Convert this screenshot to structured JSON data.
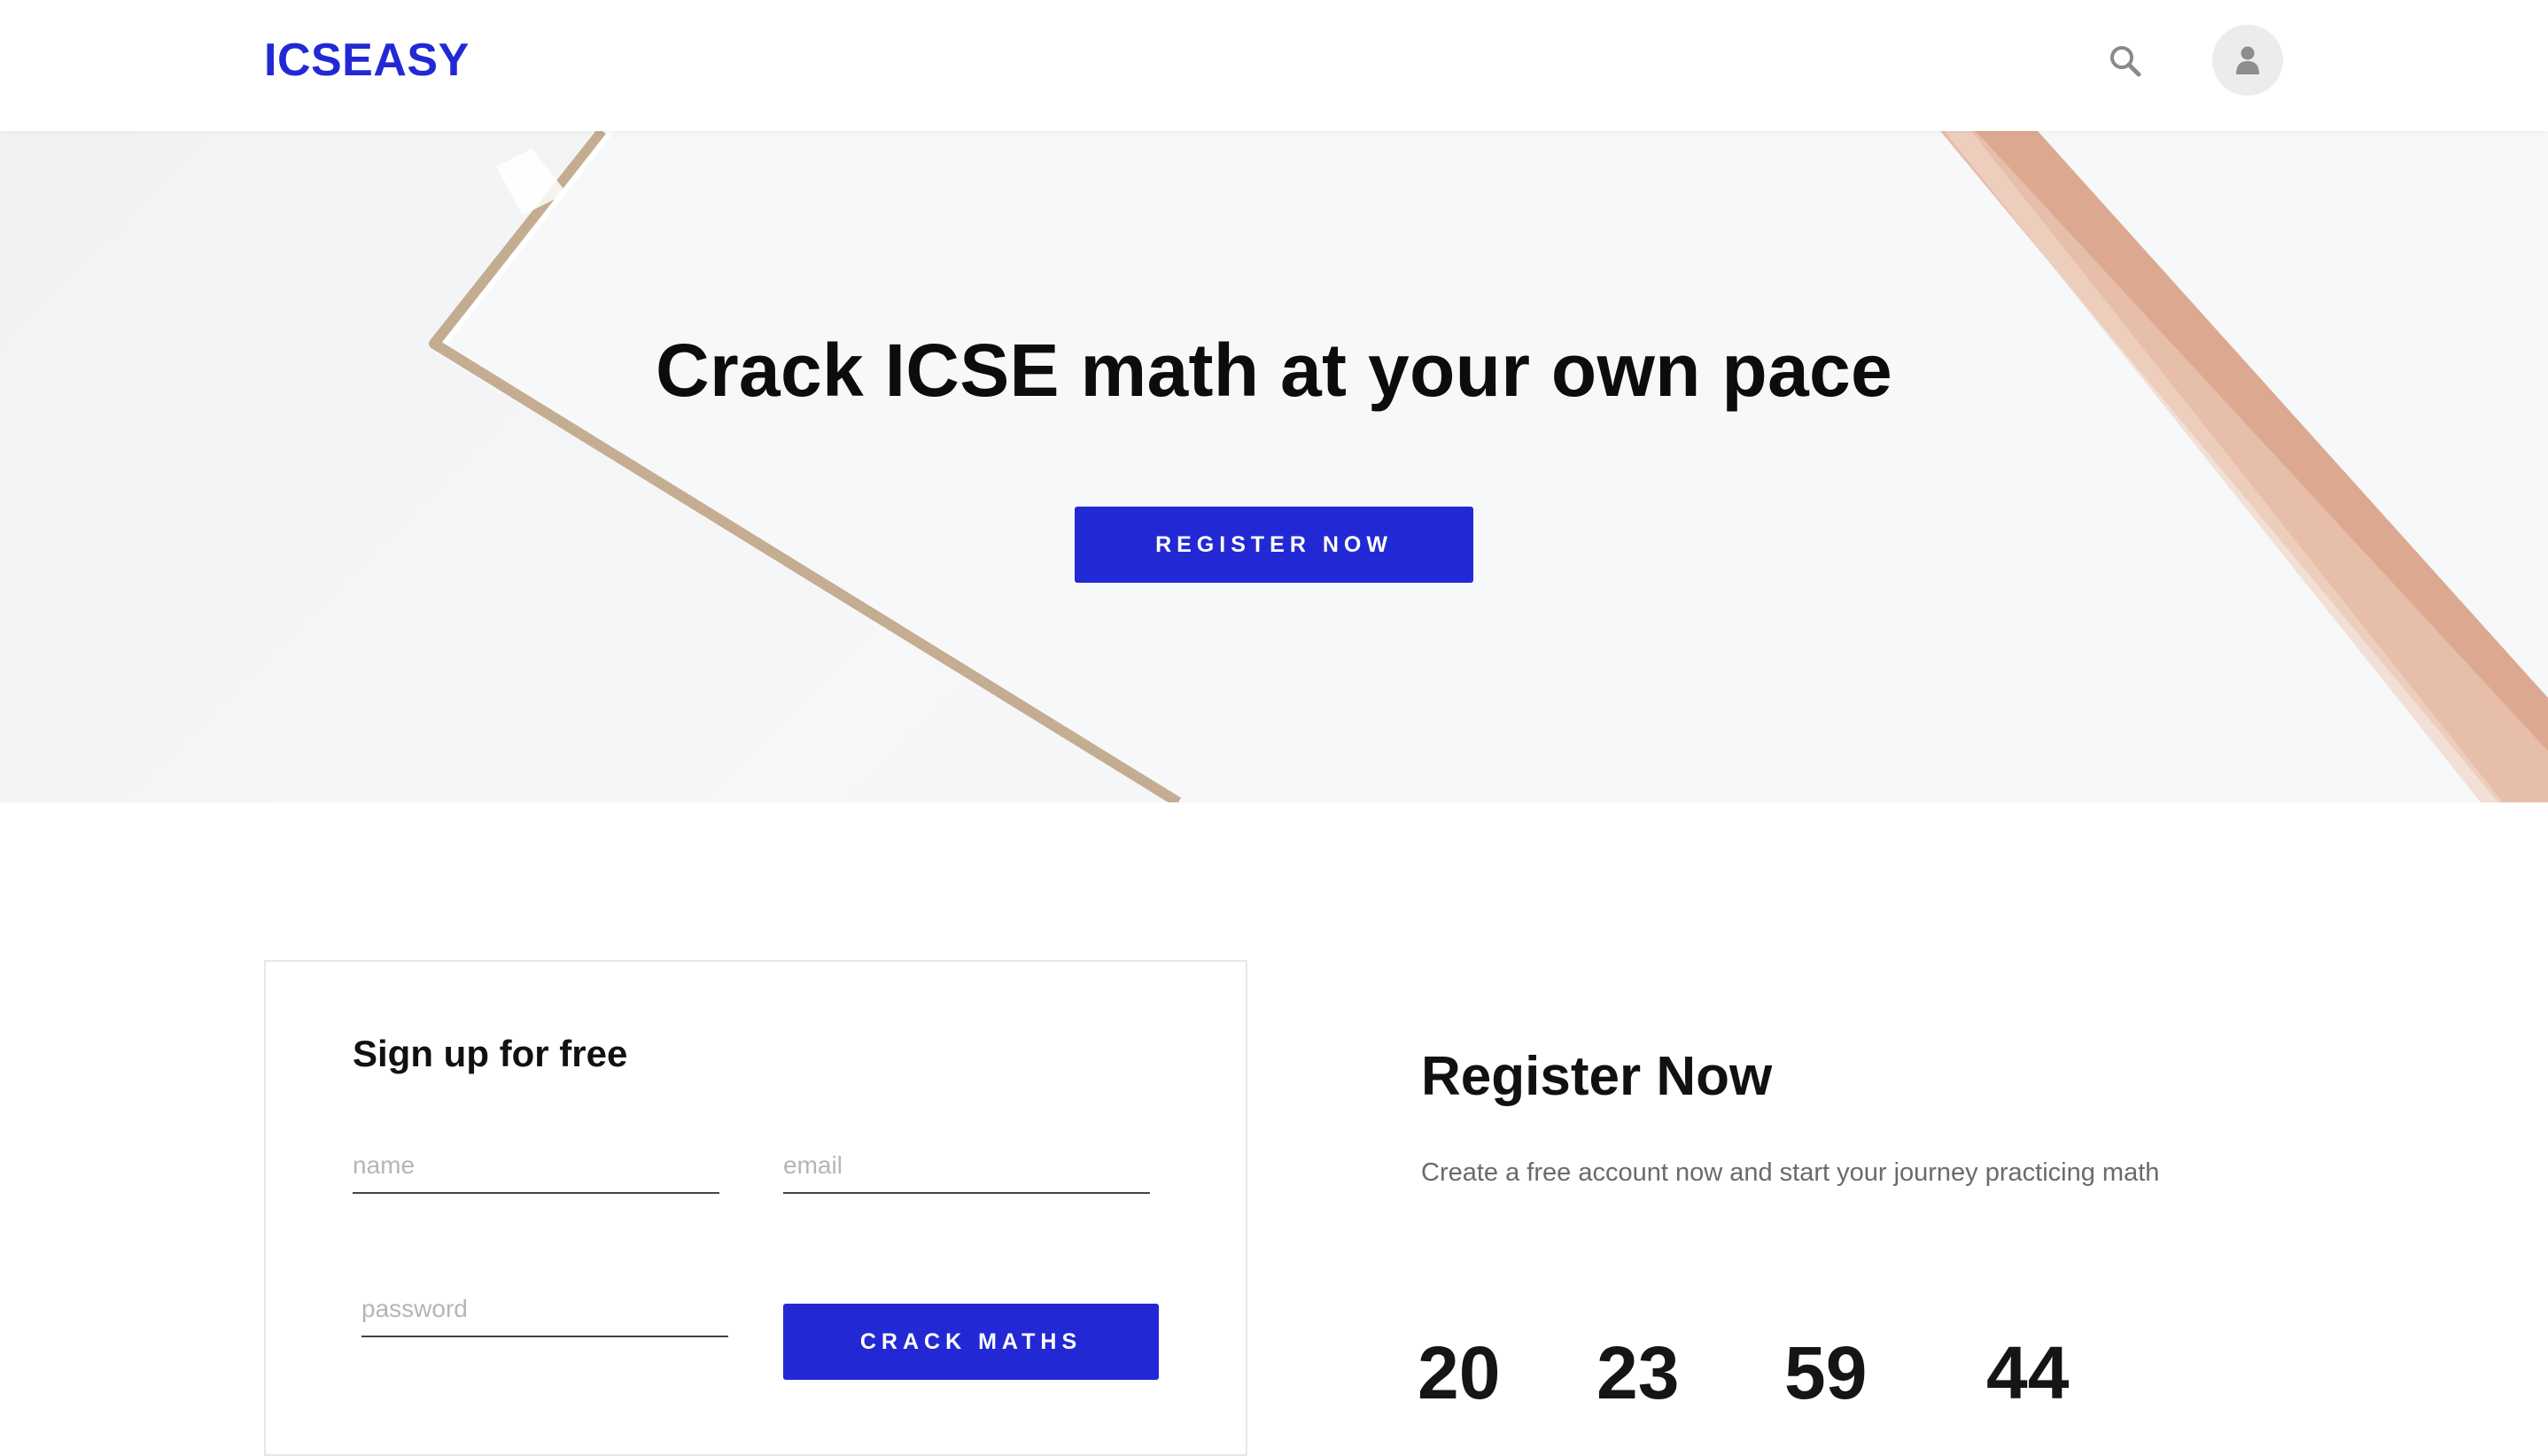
{
  "header": {
    "logo": "ICSEASY",
    "search_icon": "search-icon",
    "avatar_icon": "user-icon"
  },
  "hero": {
    "title": "Crack ICSE math at your own pace",
    "button_label": "REGISTER NOW"
  },
  "signup": {
    "title": "Sign up for free",
    "name_placeholder": "name",
    "email_placeholder": "email",
    "password_placeholder": "password",
    "submit_label": "CRACK MATHS"
  },
  "register": {
    "title": "Register Now",
    "subtitle": "Create a free account now and start your journey practicing math",
    "countdown": [
      "20",
      "23",
      "59",
      "44"
    ]
  },
  "colors": {
    "brand": "#2229d4",
    "avatar_bg": "#ececec"
  }
}
